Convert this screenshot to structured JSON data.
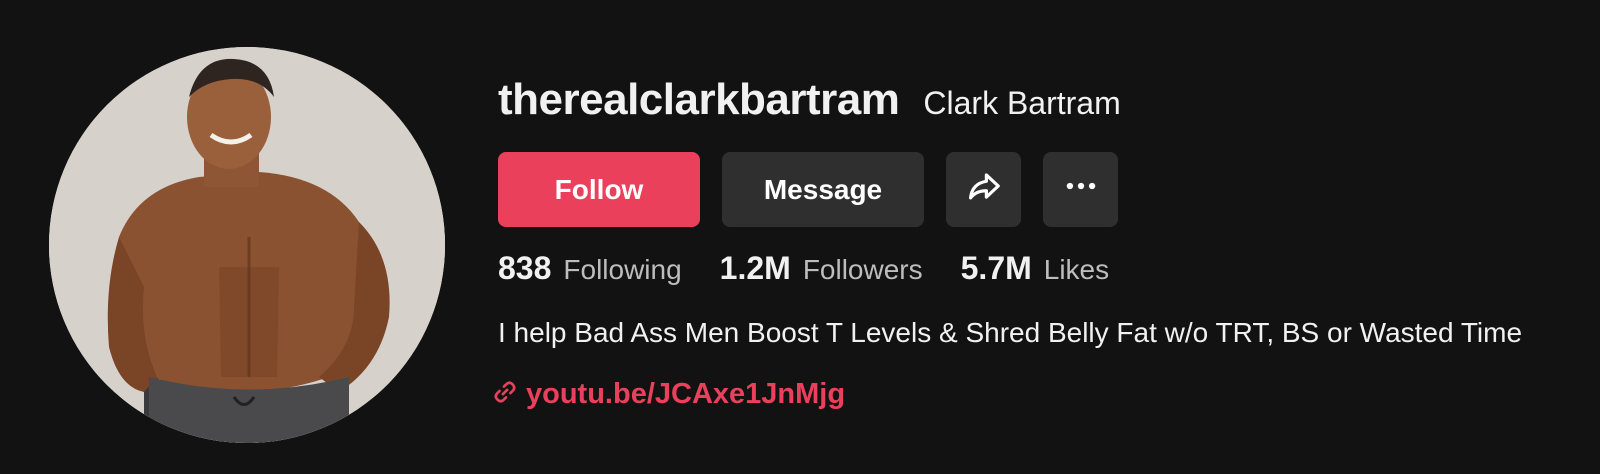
{
  "profile": {
    "username": "therealclarkbartram",
    "display_name": "Clark Bartram"
  },
  "actions": {
    "follow_label": "Follow",
    "message_label": "Message",
    "share_icon": "share-icon",
    "more_icon": "more-icon",
    "more_glyph": "···"
  },
  "stats": {
    "following": {
      "count": "838",
      "label": "Following"
    },
    "followers": {
      "count": "1.2M",
      "label": "Followers"
    },
    "likes": {
      "count": "5.7M",
      "label": "Likes"
    }
  },
  "bio": "I help Bad Ass Men Boost T Levels & Shred Belly Fat w/o TRT, BS or Wasted Time",
  "link": {
    "icon": "link-icon",
    "text": "youtu.be/JCAxe1JnMjg"
  },
  "colors": {
    "background": "#121212",
    "accent": "#ea405c",
    "secondary_button": "#2f2f2f",
    "text_primary": "#f1f1f2",
    "text_secondary": "#bdbdbd"
  }
}
